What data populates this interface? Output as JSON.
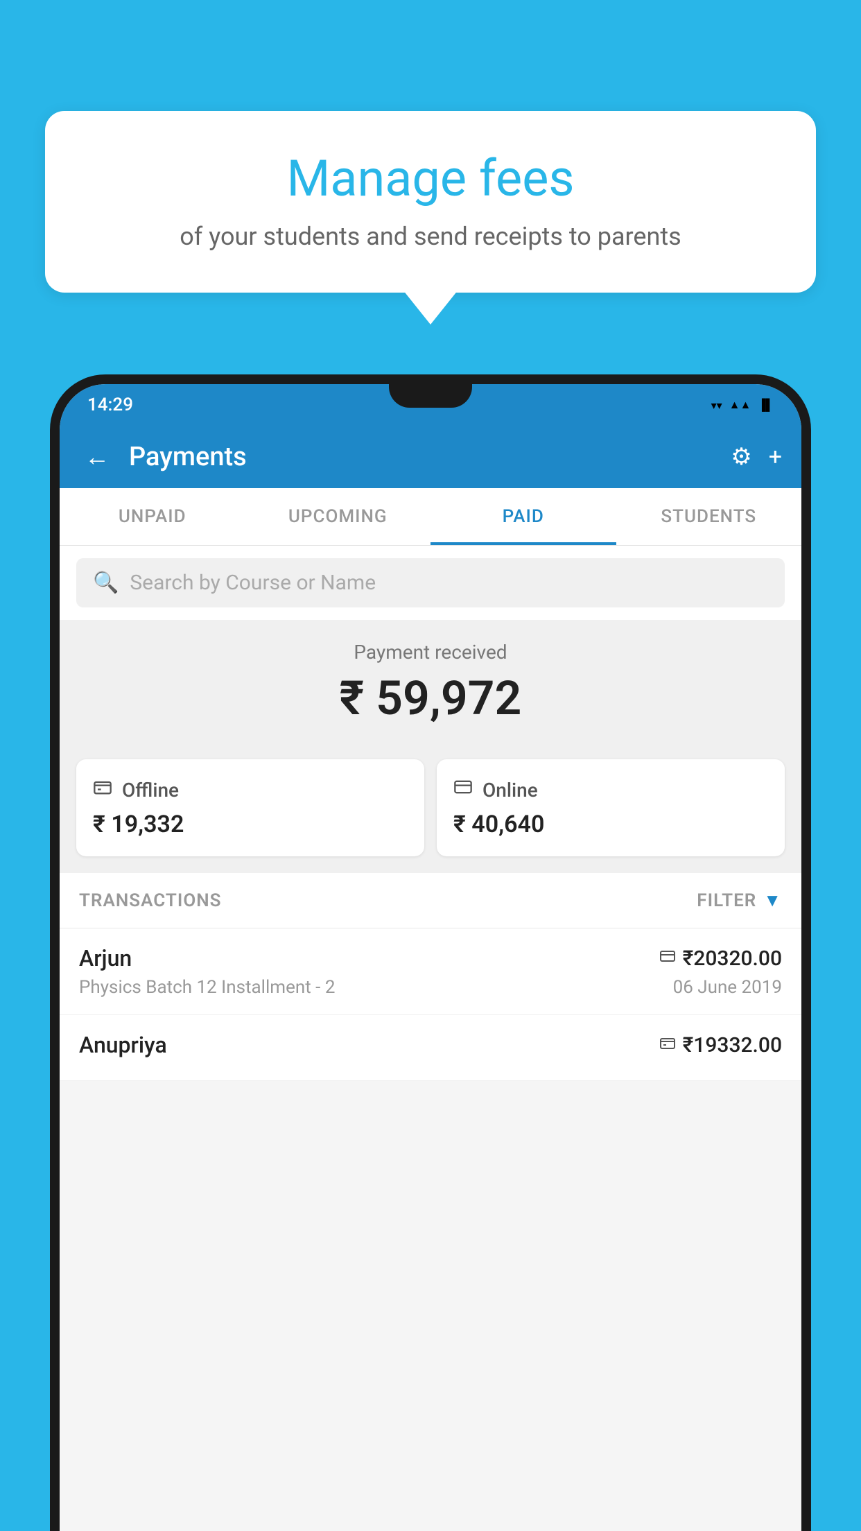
{
  "background_color": "#29b6e8",
  "bubble": {
    "title": "Manage fees",
    "subtitle": "of your students and send receipts to parents"
  },
  "status_bar": {
    "time": "14:29",
    "wifi": "▼",
    "signal": "▲",
    "battery": "▐"
  },
  "app_bar": {
    "title": "Payments",
    "back_label": "←",
    "settings_label": "⚙",
    "add_label": "+"
  },
  "tabs": [
    {
      "label": "UNPAID",
      "active": false
    },
    {
      "label": "UPCOMING",
      "active": false
    },
    {
      "label": "PAID",
      "active": true
    },
    {
      "label": "STUDENTS",
      "active": false
    }
  ],
  "search": {
    "placeholder": "Search by Course or Name"
  },
  "payment_section": {
    "label": "Payment received",
    "total_amount": "₹ 59,972",
    "offline": {
      "icon": "💳",
      "type": "Offline",
      "amount": "₹ 19,332"
    },
    "online": {
      "icon": "💳",
      "type": "Online",
      "amount": "₹ 40,640"
    }
  },
  "transactions": {
    "label": "TRANSACTIONS",
    "filter_label": "FILTER",
    "items": [
      {
        "name": "Arjun",
        "description": "Physics Batch 12 Installment - 2",
        "amount": "₹20320.00",
        "date": "06 June 2019",
        "payment_type": "online"
      },
      {
        "name": "Anupriya",
        "description": "",
        "amount": "₹19332.00",
        "date": "",
        "payment_type": "offline"
      }
    ]
  }
}
